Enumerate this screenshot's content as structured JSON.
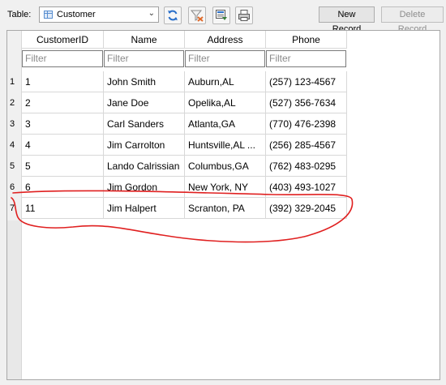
{
  "toolbar": {
    "table_label": "Table:",
    "selected_table": "Customer",
    "refresh_icon": "refresh-icon",
    "clear_filters_icon": "clear-filters-icon",
    "save_table_icon": "save-table-icon",
    "print_icon": "print-icon",
    "new_record_label": "New Record",
    "delete_record_label": "Delete Record"
  },
  "grid": {
    "columns": [
      "CustomerID",
      "Name",
      "Address",
      "Phone"
    ],
    "filter_placeholder": "Filter",
    "rows": [
      {
        "rownum": "1",
        "id": "1",
        "name": "John Smith",
        "address": "Auburn,AL",
        "phone": "(257) 123-4567"
      },
      {
        "rownum": "2",
        "id": "2",
        "name": "Jane Doe",
        "address": "Opelika,AL",
        "phone": "(527) 356-7634"
      },
      {
        "rownum": "3",
        "id": "3",
        "name": "Carl Sanders",
        "address": "Atlanta,GA",
        "phone": "(770) 476-2398"
      },
      {
        "rownum": "4",
        "id": "4",
        "name": "Jim Carrolton",
        "address": "Huntsville,AL ...",
        "phone": "(256) 285-4567"
      },
      {
        "rownum": "5",
        "id": "5",
        "name": "Lando Calrissian",
        "address": "Columbus,GA",
        "phone": "(762) 483-0295"
      },
      {
        "rownum": "6",
        "id": "6",
        "name": "Jim Gordon",
        "address": "New York, NY",
        "phone": "(403) 493-1027"
      },
      {
        "rownum": "7",
        "id": "11",
        "name": "Jim Halpert",
        "address": "Scranton, PA",
        "phone": "(392) 329-2045"
      }
    ]
  },
  "colors": {
    "annotation": "#e02020"
  }
}
